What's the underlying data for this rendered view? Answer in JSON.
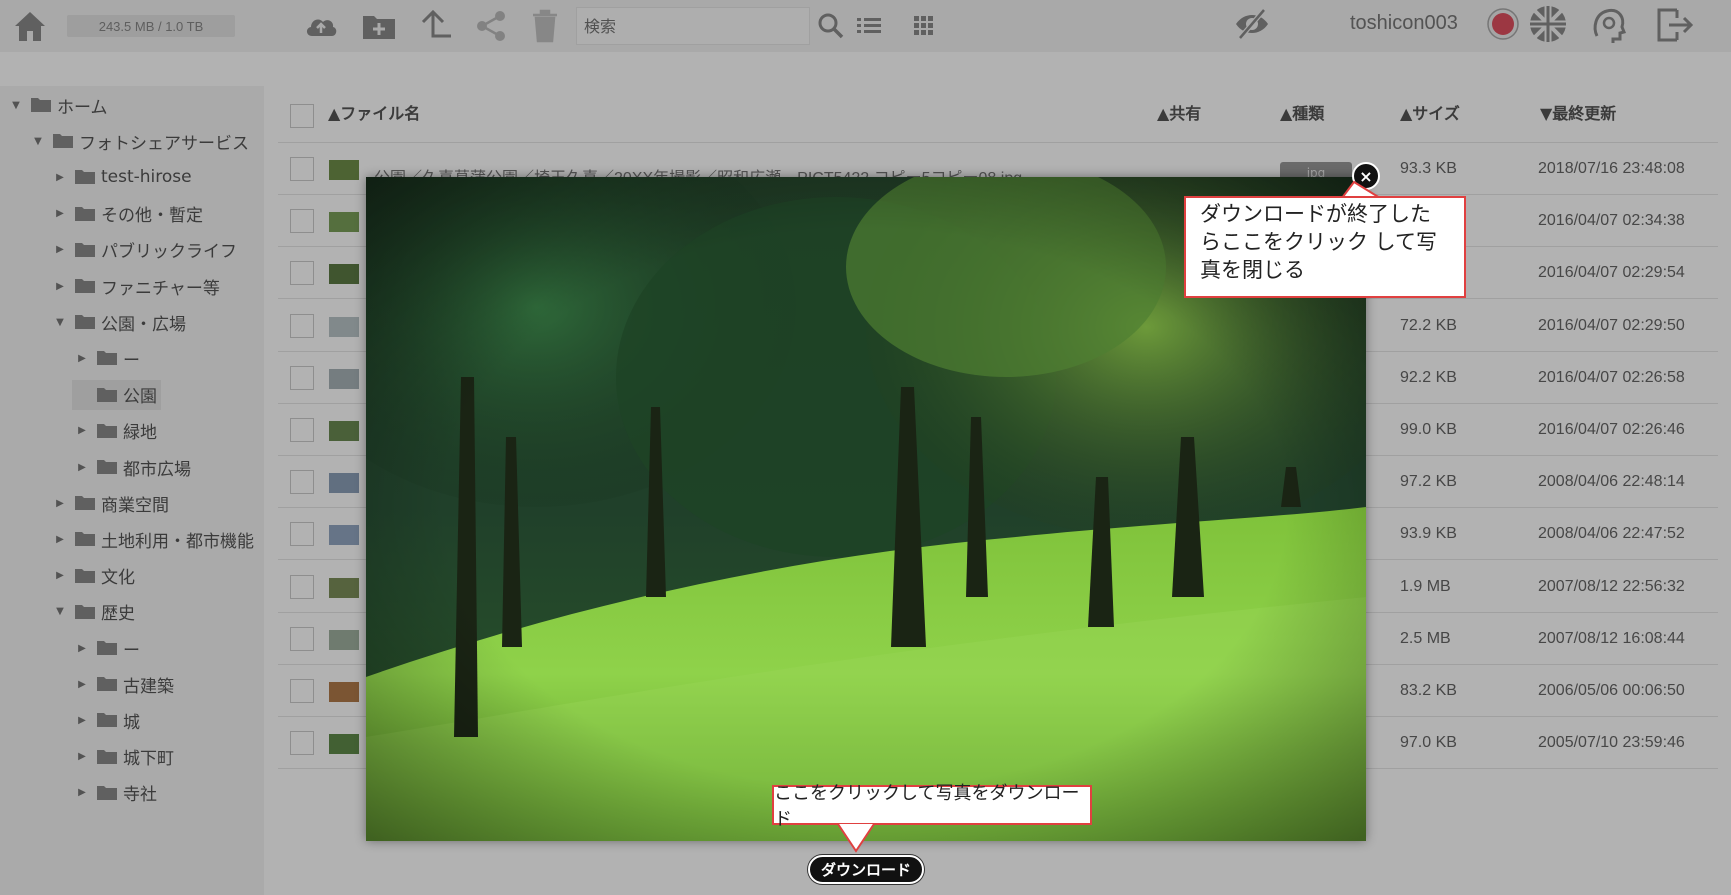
{
  "topbar": {
    "storage": "243.5 MB / 1.0 TB",
    "search_placeholder": "検索",
    "username": "toshicon003"
  },
  "sidebar": {
    "items": [
      {
        "label": "ホーム",
        "level": 0,
        "expanded": true
      },
      {
        "label": "フォトシェアサービス",
        "level": 1,
        "expanded": true
      },
      {
        "label": "test-hirose",
        "level": 2,
        "expanded": false
      },
      {
        "label": "その他・暫定",
        "level": 2,
        "expanded": false
      },
      {
        "label": "パブリックライフ",
        "level": 2,
        "expanded": false
      },
      {
        "label": "ファニチャー等",
        "level": 2,
        "expanded": false
      },
      {
        "label": "公園・広場",
        "level": 2,
        "expanded": true
      },
      {
        "label": "ー",
        "level": 3,
        "expanded": false
      },
      {
        "label": "公園",
        "level": 3,
        "expanded": null,
        "selected": true
      },
      {
        "label": "緑地",
        "level": 3,
        "expanded": false
      },
      {
        "label": "都市広場",
        "level": 3,
        "expanded": false
      },
      {
        "label": "商業空間",
        "level": 2,
        "expanded": false
      },
      {
        "label": "土地利用・都市機能",
        "level": 2,
        "expanded": false
      },
      {
        "label": "文化",
        "level": 2,
        "expanded": false
      },
      {
        "label": "歴史",
        "level": 2,
        "expanded": true
      },
      {
        "label": "ー",
        "level": 3,
        "expanded": false
      },
      {
        "label": "古建築",
        "level": 3,
        "expanded": false
      },
      {
        "label": "城",
        "level": 3,
        "expanded": false
      },
      {
        "label": "城下町",
        "level": 3,
        "expanded": false
      },
      {
        "label": "寺社",
        "level": 3,
        "expanded": false
      }
    ]
  },
  "list": {
    "headers": {
      "name": "▲ファイル名",
      "share": "▲共有",
      "type": "▲種類",
      "size": "▲サイズ",
      "updated": "▼最終更新"
    },
    "first_file_name": "公園／久喜菖蒲公園／埼玉久喜／20XX年撮影／昭和広瀬　PICT5422 コピー5コピー08.jpg",
    "first_file_type": "jpg",
    "rows": [
      {
        "size": "93.3 KB",
        "updated": "2018/07/16 23:48:08"
      },
      {
        "size": "",
        "updated": "2016/04/07 02:34:38"
      },
      {
        "size": "",
        "updated": "2016/04/07 02:29:54"
      },
      {
        "size": "72.2 KB",
        "updated": "2016/04/07 02:29:50"
      },
      {
        "size": "92.2 KB",
        "updated": "2016/04/07 02:26:58"
      },
      {
        "size": "99.0 KB",
        "updated": "2016/04/07 02:26:46"
      },
      {
        "size": "97.2 KB",
        "updated": "2008/04/06 22:48:14"
      },
      {
        "size": "93.9 KB",
        "updated": "2008/04/06 22:47:52"
      },
      {
        "size": "1.9 MB",
        "updated": "2007/08/12 22:56:32"
      },
      {
        "size": "2.5 MB",
        "updated": "2007/08/12 16:08:44"
      },
      {
        "size": "83.2 KB",
        "updated": "2006/05/06 00:06:50"
      },
      {
        "size": "97.0 KB",
        "updated": "2005/07/10 23:59:46"
      }
    ]
  },
  "modal": {
    "close_label": "×",
    "close_callout": "ダウンロードが終了したらここをクリック して写真を閉じる",
    "download_callout": "ここをクリックして写真をダウンロード",
    "download_button": "ダウンロード"
  }
}
